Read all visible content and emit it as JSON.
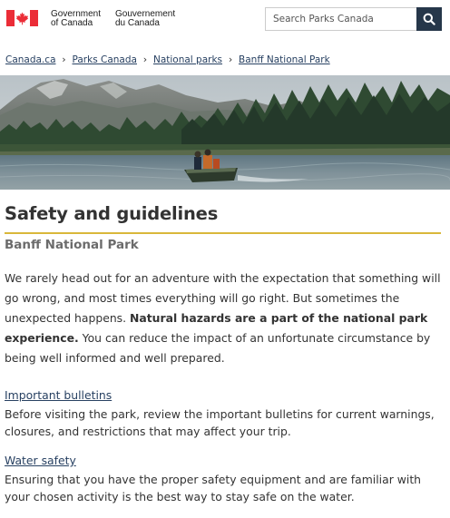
{
  "header": {
    "signature_en_line1": "Government",
    "signature_en_line2": "of Canada",
    "signature_fr_line1": "Gouvernement",
    "signature_fr_line2": "du Canada",
    "search_placeholder": "Search Parks Canada",
    "flag_red": "#eb2d37",
    "search_button_color": "#26374a"
  },
  "breadcrumb": {
    "items": [
      "Canada.ca",
      "Parks Canada",
      "National parks",
      "Banff National Park"
    ]
  },
  "banner": {
    "image": "river-boat-mountains"
  },
  "page": {
    "title": "Safety and guidelines",
    "subtitle": "Banff National Park",
    "intro_part1": "We rarely head out for an adventure with the expectation that something will go wrong, and most times everything will go right. But sometimes the unexpected happens. ",
    "intro_bold": "Natural hazards are a part of the national park experience.",
    "intro_part2": " You can reduce the impact of an unfortunate circumstance by being well informed and well prepared.",
    "accent_color": "#d9b73a"
  },
  "sections": [
    {
      "heading": "Important bulletins",
      "text": "Before visiting the park, review the important bulletins for current warnings, closures, and restrictions that may affect your trip."
    },
    {
      "heading": "Water safety",
      "text": "Ensuring that you have the proper safety equipment and are familiar with your chosen activity is the best way to stay safe on the water."
    }
  ]
}
